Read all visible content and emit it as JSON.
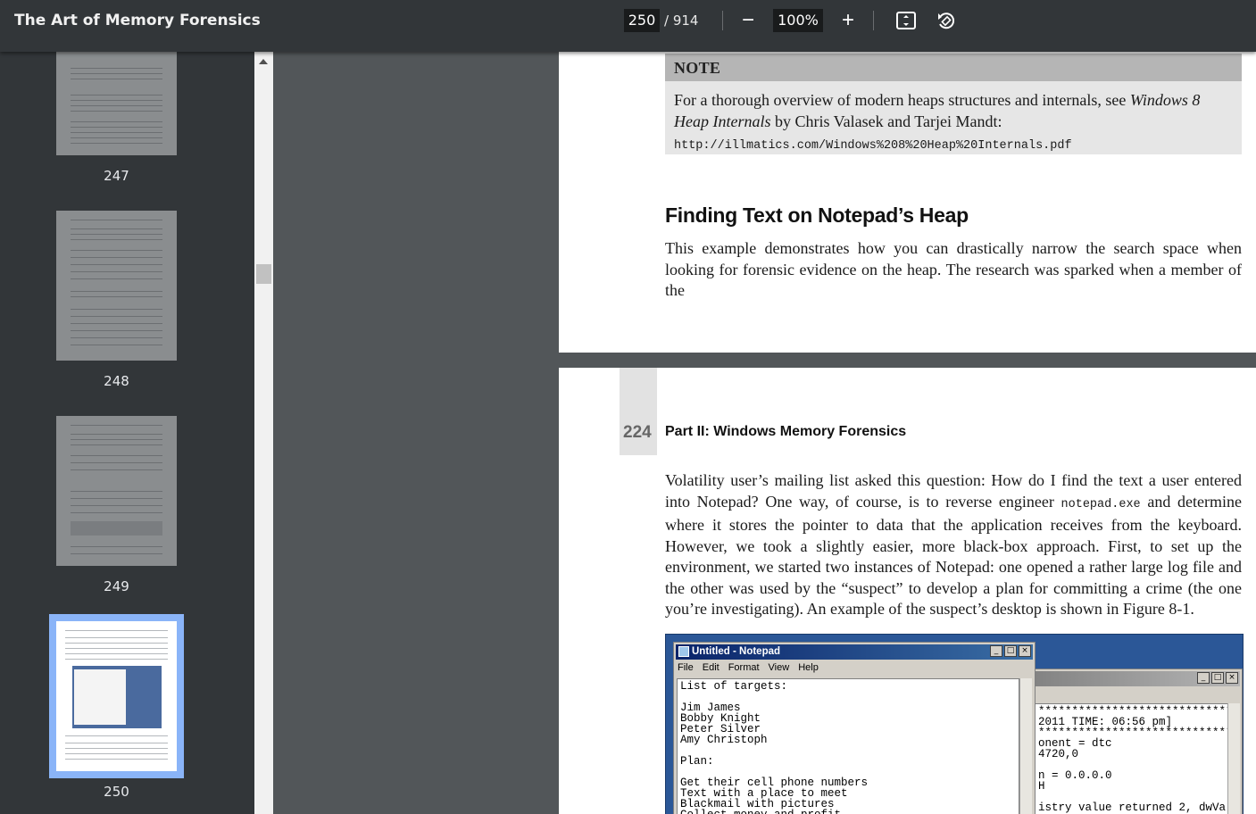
{
  "toolbar": {
    "title": "The Art of Memory Forensics",
    "current_page": "250",
    "total_pages": "/ 914",
    "zoom": "100%",
    "zoom_out": "−",
    "zoom_in": "+"
  },
  "thumbnails": [
    {
      "label": "247"
    },
    {
      "label": "248"
    },
    {
      "label": "249"
    },
    {
      "label": "250"
    }
  ],
  "page_top": {
    "note_heading": "NOTE",
    "note_text_1": "For a thorough overview of modern heaps structures and internals, see ",
    "note_italic": "Windows 8 Heap Internals",
    "note_text_2": " by Chris Valasek and Tarjei Mandt: ",
    "note_url": "http://illmatics.com/Windows%208%20Heap%20Internals.pdf",
    "heading": "Finding Text on Notepad’s Heap",
    "para": "This example demonstrates how you can drastically narrow the search space when looking for forensic evidence on the heap. The research was sparked when a member of the"
  },
  "page_bottom": {
    "page_number": "224",
    "running_head": "Part II: Windows Memory Forensics",
    "para_a": "Volatility user’s mailing list asked this question: How do I find the text a user entered into Notepad? One way, of course, is to reverse engineer ",
    "para_code": "notepad.exe",
    "para_b": " and determine where it stores the pointer to data that the application receives from the keyboard. However, we took a slightly easier, more black-box approach. First, to set up the environment, we started two instances of Notepad: one opened a rather large log file and the other was used by the “suspect” to develop a plan for committing a crime (the one you’re investigating). An example of the suspect’s desktop is shown in Figure 8-1.",
    "figure": {
      "notepad_title": "Untitled - Notepad",
      "menu": [
        "File",
        "Edit",
        "Format",
        "View",
        "Help"
      ],
      "notepad_text": "List of targets:\n\nJim James\nBobby Knight\nPeter Silver\nAmy Christoph\n\nPlan:\n\nGet their cell phone numbers\nText with a place to meet\nBlackmail with pictures\nCollect money and profit",
      "log_text": "************************************\n2011 TIME: 06:56 pm]\n************************************\nonent = dtc\n4720,0\n\nn = 0.0.0.0\nH\n\nistry value returned 2, dwVa"
    }
  }
}
